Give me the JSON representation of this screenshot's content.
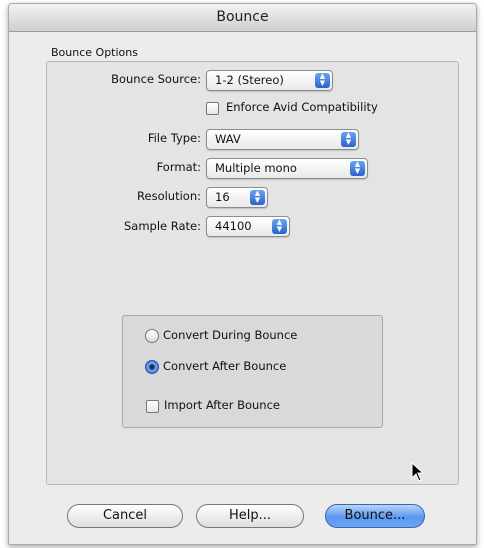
{
  "window": {
    "title": "Bounce"
  },
  "group": {
    "title": "Bounce Options"
  },
  "bounce_source": {
    "label": "Bounce Source:",
    "value": "1-2 (Stereo)"
  },
  "enforce_avid": {
    "label": "Enforce Avid Compatibility",
    "checked": false
  },
  "file_type": {
    "label": "File Type:",
    "value": "WAV"
  },
  "format": {
    "label": "Format:",
    "value": "Multiple mono"
  },
  "resolution": {
    "label": "Resolution:",
    "value": "16"
  },
  "sample_rate": {
    "label": "Sample Rate:",
    "value": "44100"
  },
  "conversion": {
    "options": [
      "Convert During Bounce",
      "Convert After Bounce"
    ],
    "selected": "Convert After Bounce"
  },
  "import_after": {
    "label": "Import After Bounce",
    "checked": false
  },
  "buttons": {
    "cancel": "Cancel",
    "help": "Help...",
    "bounce": "Bounce..."
  },
  "colors": {
    "accent": "#4f8ce8",
    "window_bg": "#ececec"
  },
  "icons": {
    "popup_arrows": "up-down-arrows-icon",
    "cursor": "mouse-pointer-icon"
  }
}
